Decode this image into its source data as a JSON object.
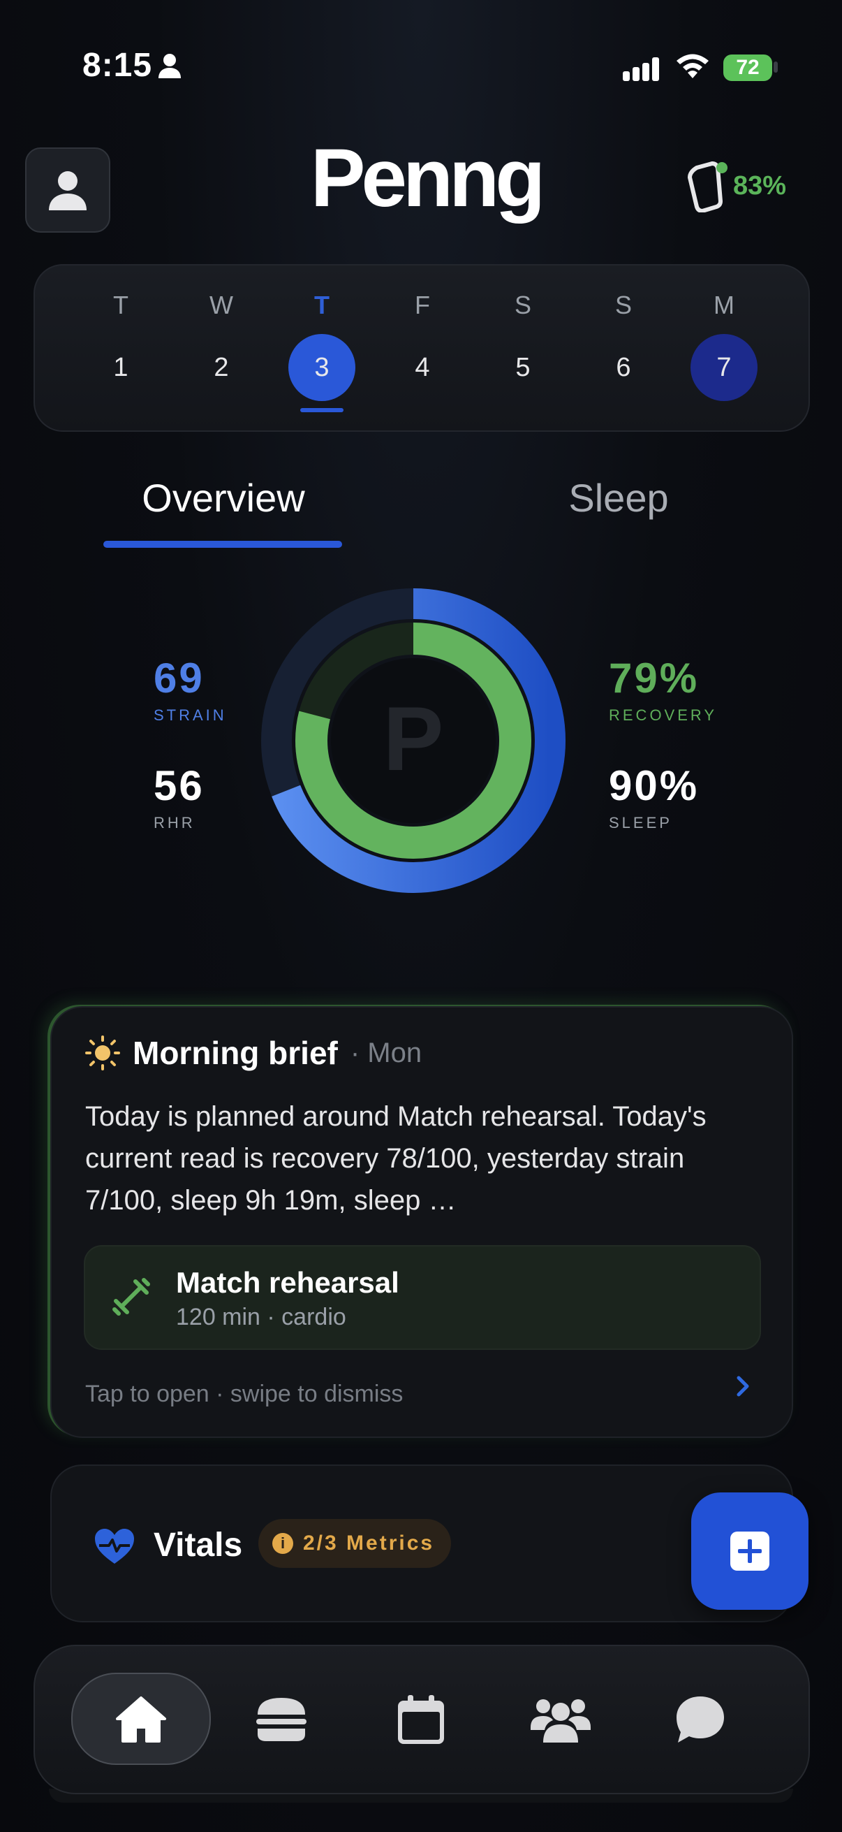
{
  "status_bar": {
    "time": "8:15",
    "battery": "72"
  },
  "header": {
    "brand": "Penng",
    "device_battery": "83%"
  },
  "week": {
    "days": [
      {
        "letter": "T",
        "num": "1"
      },
      {
        "letter": "W",
        "num": "2"
      },
      {
        "letter": "T",
        "num": "3"
      },
      {
        "letter": "F",
        "num": "4"
      },
      {
        "letter": "S",
        "num": "5"
      },
      {
        "letter": "S",
        "num": "6"
      },
      {
        "letter": "M",
        "num": "7"
      }
    ],
    "selected_index": 2,
    "today_index": 6
  },
  "tabs": {
    "overview": "Overview",
    "sleep": "Sleep"
  },
  "stats": {
    "strain": {
      "value": "69",
      "label": "STRAIN"
    },
    "rhr": {
      "value": "56",
      "label": "RHR"
    },
    "recovery": {
      "value": "79%",
      "label": "RECOVERY"
    },
    "sleep": {
      "value": "90%",
      "label": "SLEEP"
    },
    "strain_ring_fraction": 0.69,
    "recovery_ring_fraction": 0.79,
    "center_logo": "P"
  },
  "brief": {
    "title": "Morning brief",
    "day": "· Mon",
    "body": "Today is planned around Match rehearsal. Today's current read is recovery 78/100, yesterday strain 7/100, sleep 9h 19m, sleep …",
    "workout_name": "Match rehearsal",
    "workout_meta": "120 min · cardio",
    "hint": "Tap to open · swipe to dismiss"
  },
  "vitals": {
    "title": "Vitals",
    "badge": "2/3 Metrics",
    "badge_icon": "i"
  },
  "colors": {
    "accent_blue": "#2a58d8",
    "green": "#5fae5a",
    "amber": "#e3a94a"
  },
  "icons": [
    "person-icon",
    "signal-icon",
    "wifi-icon",
    "watch-icon",
    "sun-icon",
    "dumbbell-icon",
    "chevron-right-icon",
    "heart-pulse-icon",
    "plus-icon",
    "home-icon",
    "burger-icon",
    "calendar-icon",
    "people-icon",
    "chat-icon"
  ]
}
